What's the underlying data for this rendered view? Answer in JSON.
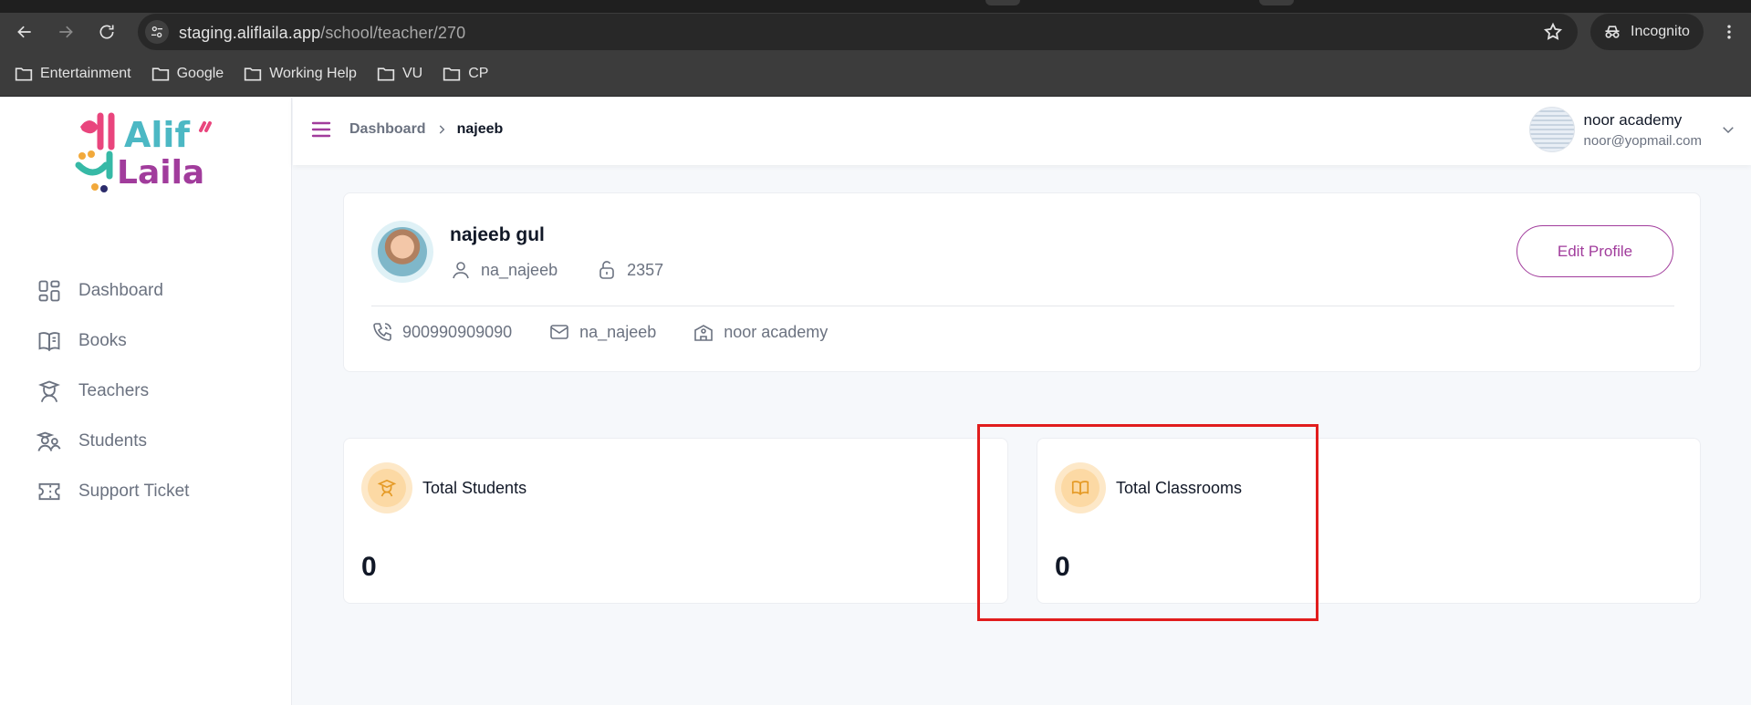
{
  "browser": {
    "url_domain": "staging.aliflaila.app",
    "url_path": "/school/teacher/270",
    "incognito_label": "Incognito",
    "bookmarks": [
      "Entertainment",
      "Google",
      "Working Help",
      "VU",
      "CP"
    ]
  },
  "sidebar": {
    "logo_text_top": "Alif",
    "logo_text_bottom": "Laila",
    "items": [
      {
        "label": "Dashboard",
        "icon": "grid-icon"
      },
      {
        "label": "Books",
        "icon": "book-icon"
      },
      {
        "label": "Teachers",
        "icon": "teacher-icon"
      },
      {
        "label": "Students",
        "icon": "students-icon"
      },
      {
        "label": "Support Ticket",
        "icon": "ticket-icon"
      }
    ]
  },
  "header": {
    "breadcrumb": {
      "parent": "Dashboard",
      "current": "najeeb"
    },
    "user": {
      "name": "noor academy",
      "email": "noor@yopmail.com"
    }
  },
  "profile": {
    "name": "najeeb gul",
    "username": "na_najeeb",
    "pin": "2357",
    "phone": "900990909090",
    "email": "na_najeeb",
    "school": "noor academy",
    "edit_label": "Edit Profile"
  },
  "stats": [
    {
      "label": "Total Students",
      "value": "0",
      "icon": "graduate-icon"
    },
    {
      "label": "Total Classrooms",
      "value": "0",
      "icon": "open-book-icon"
    }
  ],
  "colors": {
    "accent": "#a13c9c",
    "highlight": "#e11d1d",
    "stat_icon_bg": "#fde8c8"
  }
}
